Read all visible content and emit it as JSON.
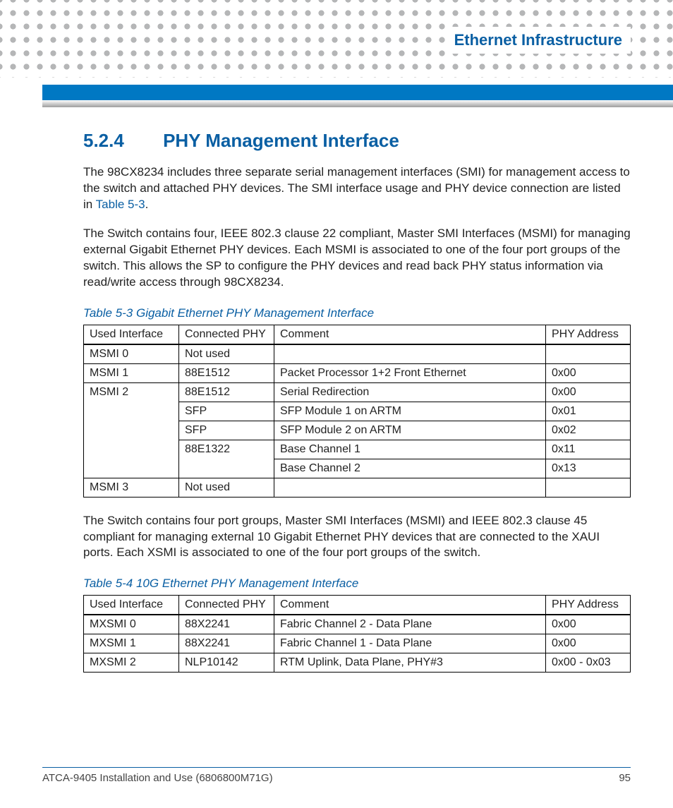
{
  "header": {
    "chapter": "Ethernet Infrastructure"
  },
  "section": {
    "number": "5.2.4",
    "title": "PHY Management Interface"
  },
  "paragraphs": {
    "p1a": "The 98CX8234 includes three separate serial management interfaces (SMI) for management access to the switch and attached PHY devices. The SMI interface usage and PHY device connection are listed in ",
    "p1link": "Table 5-3",
    "p1b": ".",
    "p2": "The Switch contains four, IEEE 802.3 clause 22 compliant, Master SMI Interfaces (MSMI) for managing external Gigabit Ethernet PHY devices. Each MSMI is associated to one of the four port groups of the switch. This allows the SP to configure the PHY devices and read back PHY status information via read/write access through 98CX8234.",
    "p3": "The Switch contains four port groups, Master SMI Interfaces (MSMI) and IEEE 802.3 clause 45 compliant for managing external 10 Gigabit Ethernet PHY devices that are connected to the XAUI ports. Each XSMI is associated to one of the four port groups of the switch."
  },
  "table53": {
    "caption": "Table 5-3 Gigabit Ethernet PHY Management Interface",
    "headers": {
      "c1": "Used Interface",
      "c2": "Connected PHY",
      "c3": "Comment",
      "c4": "PHY Address"
    },
    "rows": {
      "r1": {
        "iface": "MSMI 0",
        "phy": "Not used",
        "comment": "",
        "addr": ""
      },
      "r2": {
        "iface": "MSMI 1",
        "phy": "88E1512",
        "comment": "Packet Processor 1+2 Front Ethernet",
        "addr": "0x00"
      },
      "r3": {
        "iface": "MSMI 2",
        "phy": "88E1512",
        "comment": "Serial Redirection",
        "addr": "0x00"
      },
      "r4": {
        "phy": "SFP",
        "comment": "SFP Module 1 on ARTM",
        "addr": "0x01"
      },
      "r5": {
        "phy": "SFP",
        "comment": "SFP Module 2 on ARTM",
        "addr": "0x02"
      },
      "r6": {
        "phy": "88E1322",
        "comment": "Base Channel 1",
        "addr": "0x11"
      },
      "r7": {
        "comment": "Base Channel 2",
        "addr": "0x13"
      },
      "r8": {
        "iface": "MSMI 3",
        "phy": "Not used",
        "comment": "",
        "addr": ""
      }
    }
  },
  "table54": {
    "caption": "Table 5-4 10G Ethernet PHY Management Interface",
    "headers": {
      "c1": "Used Interface",
      "c2": "Connected PHY",
      "c3": "Comment",
      "c4": "PHY Address"
    },
    "rows": {
      "r1": {
        "iface": "MXSMI 0",
        "phy": "88X2241",
        "comment": "Fabric Channel 2 - Data Plane",
        "addr": "0x00"
      },
      "r2": {
        "iface": "MXSMI 1",
        "phy": "88X2241",
        "comment": "Fabric Channel 1 - Data Plane",
        "addr": "0x00"
      },
      "r3": {
        "iface": "MXSMI 2",
        "phy": "NLP10142",
        "comment": "RTM Uplink, Data Plane, PHY#3",
        "addr": "0x00 - 0x03"
      }
    }
  },
  "footer": {
    "doc": "ATCA-9405 Installation and Use (6806800M71G)",
    "page": "95"
  }
}
